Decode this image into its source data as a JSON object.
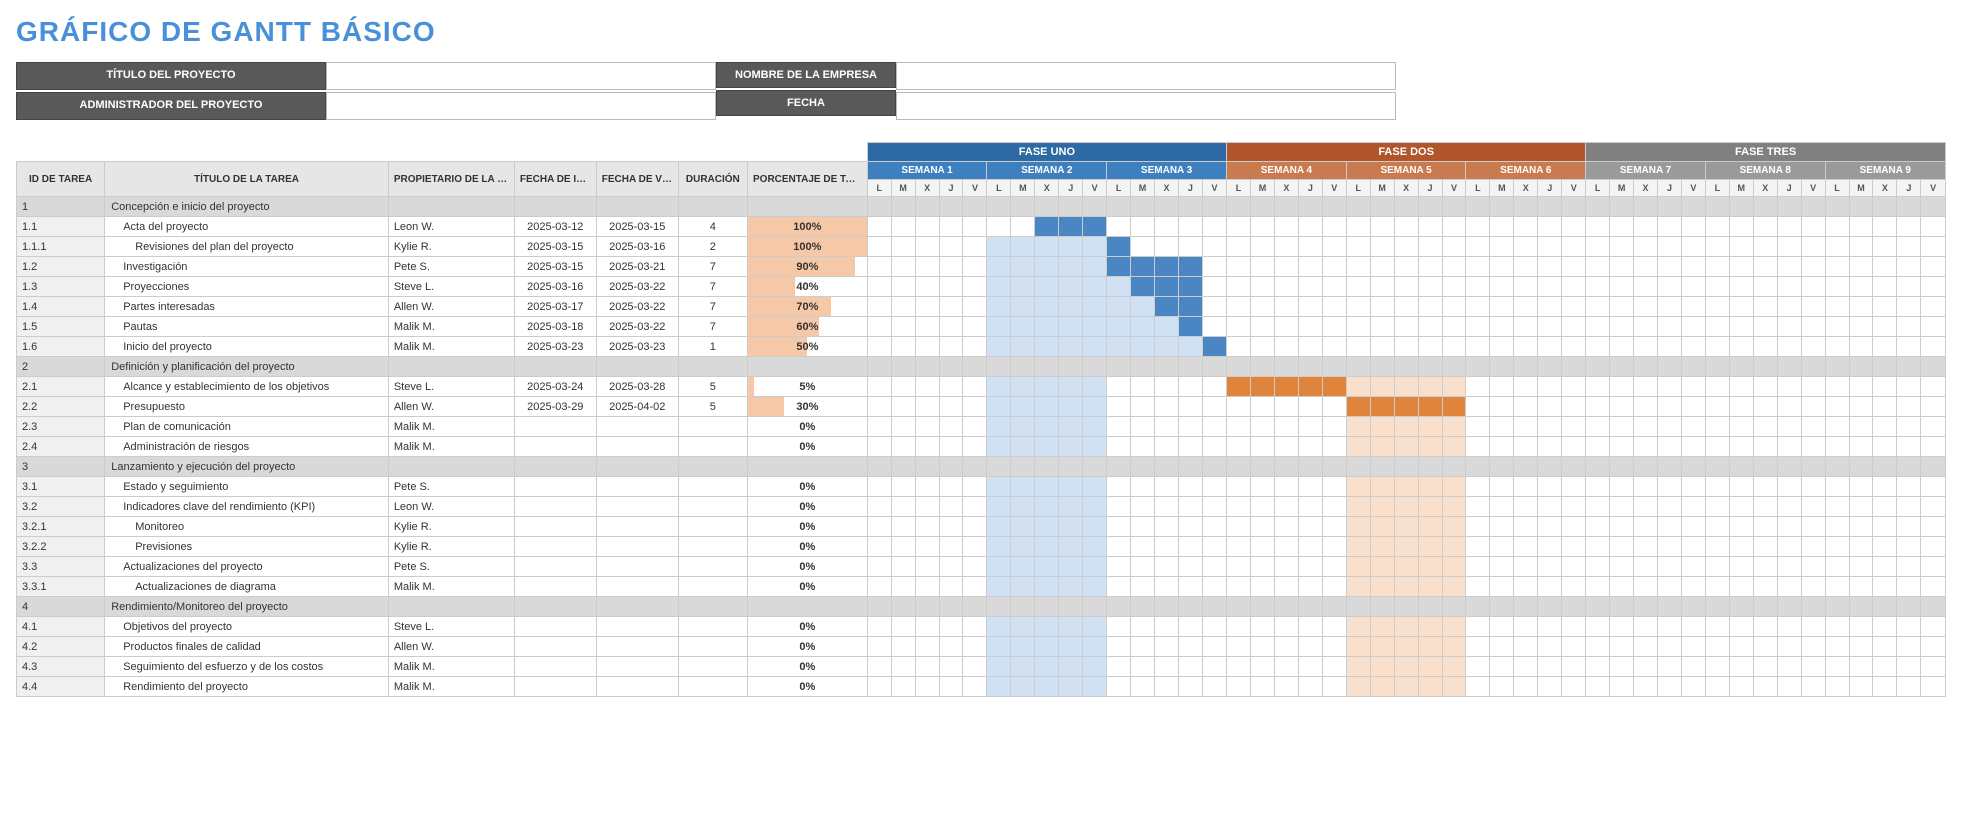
{
  "title": "GRÁFICO DE GANTT BÁSICO",
  "meta": {
    "project_title_label": "TÍTULO DEL PROYECTO",
    "project_manager_label": "ADMINISTRADOR DEL PROYECTO",
    "company_label": "NOMBRE DE LA EMPRESA",
    "date_label": "FECHA"
  },
  "columns": {
    "id": "ID DE TAREA",
    "title": "TÍTULO DE LA TAREA",
    "owner": "PROPIETARIO DE LA TAREA",
    "start": "FECHA DE INICIO",
    "due": "FECHA DE VENCIMIENTO",
    "duration": "DURACIÓN",
    "pct": "PORCENTAJE DE TAREA COMPLETADA"
  },
  "phases": [
    {
      "label": "FASE UNO",
      "cls": "ph1",
      "weekCls": "wk1",
      "weeks": [
        "SEMANA 1",
        "SEMANA 2",
        "SEMANA 3"
      ]
    },
    {
      "label": "FASE DOS",
      "cls": "ph2",
      "weekCls": "wk2",
      "weeks": [
        "SEMANA 4",
        "SEMANA 5",
        "SEMANA 6"
      ]
    },
    {
      "label": "FASE TRES",
      "cls": "ph3",
      "weekCls": "wk3",
      "weeks": [
        "SEMANA 7",
        "SEMANA 8",
        "SEMANA 9"
      ]
    }
  ],
  "days": [
    "L",
    "M",
    "X",
    "J",
    "V"
  ],
  "rows": [
    {
      "id": "1",
      "title": "Concepción e inicio del proyecto",
      "section": true
    },
    {
      "id": "1.1",
      "title": "Acta del proyecto",
      "indent": 1,
      "owner": "Leon W.",
      "start": "2025-03-12",
      "due": "2025-03-15",
      "dur": "4",
      "pct": 100,
      "bars": [
        {
          "s": 7,
          "e": 10,
          "c": "bar-blue-dark"
        }
      ]
    },
    {
      "id": "1.1.1",
      "title": "Revisiones del plan del proyecto",
      "indent": 2,
      "owner": "Kylie R.",
      "start": "2025-03-15",
      "due": "2025-03-16",
      "dur": "2",
      "pct": 100,
      "bars": [
        {
          "s": 5,
          "e": 10,
          "c": "bar-blue-light"
        },
        {
          "s": 10,
          "e": 11,
          "c": "bar-blue-dark"
        }
      ]
    },
    {
      "id": "1.2",
      "title": "Investigación",
      "indent": 1,
      "owner": "Pete S.",
      "start": "2025-03-15",
      "due": "2025-03-21",
      "dur": "7",
      "pct": 90,
      "bars": [
        {
          "s": 5,
          "e": 10,
          "c": "bar-blue-light"
        },
        {
          "s": 10,
          "e": 14,
          "c": "bar-blue-dark"
        }
      ]
    },
    {
      "id": "1.3",
      "title": "Proyecciones",
      "indent": 1,
      "owner": "Steve L.",
      "start": "2025-03-16",
      "due": "2025-03-22",
      "dur": "7",
      "pct": 40,
      "bars": [
        {
          "s": 5,
          "e": 11,
          "c": "bar-blue-light"
        },
        {
          "s": 11,
          "e": 14,
          "c": "bar-blue-dark"
        }
      ]
    },
    {
      "id": "1.4",
      "title": "Partes interesadas",
      "indent": 1,
      "owner": "Allen W.",
      "start": "2025-03-17",
      "due": "2025-03-22",
      "dur": "7",
      "pct": 70,
      "bars": [
        {
          "s": 5,
          "e": 12,
          "c": "bar-blue-light"
        },
        {
          "s": 12,
          "e": 14,
          "c": "bar-blue-dark"
        }
      ]
    },
    {
      "id": "1.5",
      "title": "Pautas",
      "indent": 1,
      "owner": "Malik M.",
      "start": "2025-03-18",
      "due": "2025-03-22",
      "dur": "7",
      "pct": 60,
      "bars": [
        {
          "s": 5,
          "e": 13,
          "c": "bar-blue-light"
        },
        {
          "s": 13,
          "e": 14,
          "c": "bar-blue-dark"
        }
      ]
    },
    {
      "id": "1.6",
      "title": "Inicio del proyecto",
      "indent": 1,
      "owner": "Malik M.",
      "start": "2025-03-23",
      "due": "2025-03-23",
      "dur": "1",
      "pct": 50,
      "bars": [
        {
          "s": 5,
          "e": 14,
          "c": "bar-blue-light"
        },
        {
          "s": 14,
          "e": 15,
          "c": "bar-blue-dark"
        }
      ]
    },
    {
      "id": "2",
      "title": "Definición y planificación del proyecto",
      "section": true
    },
    {
      "id": "2.1",
      "title": "Alcance y establecimiento de los objetivos",
      "indent": 1,
      "owner": "Steve L.",
      "start": "2025-03-24",
      "due": "2025-03-28",
      "dur": "5",
      "pct": 5,
      "bars": [
        {
          "s": 5,
          "e": 10,
          "c": "bar-blue-light"
        },
        {
          "s": 15,
          "e": 20,
          "c": "bar-orange-dark"
        },
        {
          "s": 20,
          "e": 25,
          "c": "bar-orange-light"
        }
      ]
    },
    {
      "id": "2.2",
      "title": "Presupuesto",
      "indent": 1,
      "owner": "Allen W.",
      "start": "2025-03-29",
      "due": "2025-04-02",
      "dur": "5",
      "pct": 30,
      "bars": [
        {
          "s": 5,
          "e": 10,
          "c": "bar-blue-light"
        },
        {
          "s": 20,
          "e": 25,
          "c": "bar-orange-dark"
        }
      ]
    },
    {
      "id": "2.3",
      "title": "Plan de comunicación",
      "indent": 1,
      "owner": "Malik M.",
      "pct": 0,
      "bars": [
        {
          "s": 5,
          "e": 10,
          "c": "bar-blue-light"
        },
        {
          "s": 20,
          "e": 25,
          "c": "bar-orange-light"
        }
      ]
    },
    {
      "id": "2.4",
      "title": "Administración de riesgos",
      "indent": 1,
      "owner": "Malik M.",
      "pct": 0,
      "bars": [
        {
          "s": 5,
          "e": 10,
          "c": "bar-blue-light"
        },
        {
          "s": 20,
          "e": 25,
          "c": "bar-orange-light"
        }
      ]
    },
    {
      "id": "3",
      "title": "Lanzamiento y ejecución del proyecto",
      "section": true
    },
    {
      "id": "3.1",
      "title": "Estado y seguimiento",
      "indent": 1,
      "owner": "Pete S.",
      "pct": 0,
      "bars": [
        {
          "s": 5,
          "e": 10,
          "c": "bar-blue-light"
        },
        {
          "s": 20,
          "e": 25,
          "c": "bar-orange-light"
        }
      ]
    },
    {
      "id": "3.2",
      "title": "Indicadores clave del rendimiento (KPI)",
      "indent": 1,
      "owner": "Leon W.",
      "pct": 0,
      "bars": [
        {
          "s": 5,
          "e": 10,
          "c": "bar-blue-light"
        },
        {
          "s": 20,
          "e": 25,
          "c": "bar-orange-light"
        }
      ]
    },
    {
      "id": "3.2.1",
      "title": "Monitoreo",
      "indent": 2,
      "owner": "Kylie R.",
      "pct": 0,
      "bars": [
        {
          "s": 5,
          "e": 10,
          "c": "bar-blue-light"
        },
        {
          "s": 20,
          "e": 25,
          "c": "bar-orange-light"
        }
      ]
    },
    {
      "id": "3.2.2",
      "title": "Previsiones",
      "indent": 2,
      "owner": "Kylie R.",
      "pct": 0,
      "bars": [
        {
          "s": 5,
          "e": 10,
          "c": "bar-blue-light"
        },
        {
          "s": 20,
          "e": 25,
          "c": "bar-orange-light"
        }
      ]
    },
    {
      "id": "3.3",
      "title": "Actualizaciones del proyecto",
      "indent": 1,
      "owner": "Pete S.",
      "pct": 0,
      "bars": [
        {
          "s": 5,
          "e": 10,
          "c": "bar-blue-light"
        },
        {
          "s": 20,
          "e": 25,
          "c": "bar-orange-light"
        }
      ]
    },
    {
      "id": "3.3.1",
      "title": "Actualizaciones de diagrama",
      "indent": 2,
      "owner": "Malik M.",
      "pct": 0,
      "bars": [
        {
          "s": 5,
          "e": 10,
          "c": "bar-blue-light"
        },
        {
          "s": 20,
          "e": 25,
          "c": "bar-orange-light"
        }
      ]
    },
    {
      "id": "4",
      "title": "Rendimiento/Monitoreo del proyecto",
      "section": true
    },
    {
      "id": "4.1",
      "title": "Objetivos del proyecto",
      "indent": 1,
      "owner": "Steve L.",
      "pct": 0,
      "bars": [
        {
          "s": 5,
          "e": 10,
          "c": "bar-blue-light"
        },
        {
          "s": 20,
          "e": 25,
          "c": "bar-orange-light"
        }
      ]
    },
    {
      "id": "4.2",
      "title": "Productos finales de calidad",
      "indent": 1,
      "owner": "Allen W.",
      "pct": 0,
      "bars": [
        {
          "s": 5,
          "e": 10,
          "c": "bar-blue-light"
        },
        {
          "s": 20,
          "e": 25,
          "c": "bar-orange-light"
        }
      ]
    },
    {
      "id": "4.3",
      "title": "Seguimiento del esfuerzo y de los costos",
      "indent": 1,
      "owner": "Malik M.",
      "pct": 0,
      "bars": [
        {
          "s": 5,
          "e": 10,
          "c": "bar-blue-light"
        },
        {
          "s": 20,
          "e": 25,
          "c": "bar-orange-light"
        }
      ]
    },
    {
      "id": "4.4",
      "title": "Rendimiento del proyecto",
      "indent": 1,
      "owner": "Malik M.",
      "pct": 0,
      "bars": [
        {
          "s": 5,
          "e": 10,
          "c": "bar-blue-light"
        },
        {
          "s": 20,
          "e": 25,
          "c": "bar-orange-light"
        }
      ]
    }
  ],
  "chart_data": {
    "type": "gantt",
    "title": "GRÁFICO DE GANTT BÁSICO",
    "phases": [
      "FASE UNO",
      "FASE DOS",
      "FASE TRES"
    ],
    "weeks": [
      "SEMANA 1",
      "SEMANA 2",
      "SEMANA 3",
      "SEMANA 4",
      "SEMANA 5",
      "SEMANA 6",
      "SEMANA 7",
      "SEMANA 8",
      "SEMANA 9"
    ],
    "days_per_week": [
      "L",
      "M",
      "X",
      "J",
      "V"
    ],
    "tasks": [
      {
        "id": "1.1",
        "title": "Acta del proyecto",
        "owner": "Leon W.",
        "start": "2025-03-12",
        "end": "2025-03-15",
        "duration": 4,
        "pct_complete": 100
      },
      {
        "id": "1.1.1",
        "title": "Revisiones del plan del proyecto",
        "owner": "Kylie R.",
        "start": "2025-03-15",
        "end": "2025-03-16",
        "duration": 2,
        "pct_complete": 100
      },
      {
        "id": "1.2",
        "title": "Investigación",
        "owner": "Pete S.",
        "start": "2025-03-15",
        "end": "2025-03-21",
        "duration": 7,
        "pct_complete": 90
      },
      {
        "id": "1.3",
        "title": "Proyecciones",
        "owner": "Steve L.",
        "start": "2025-03-16",
        "end": "2025-03-22",
        "duration": 7,
        "pct_complete": 40
      },
      {
        "id": "1.4",
        "title": "Partes interesadas",
        "owner": "Allen W.",
        "start": "2025-03-17",
        "end": "2025-03-22",
        "duration": 7,
        "pct_complete": 70
      },
      {
        "id": "1.5",
        "title": "Pautas",
        "owner": "Malik M.",
        "start": "2025-03-18",
        "end": "2025-03-22",
        "duration": 7,
        "pct_complete": 60
      },
      {
        "id": "1.6",
        "title": "Inicio del proyecto",
        "owner": "Malik M.",
        "start": "2025-03-23",
        "end": "2025-03-23",
        "duration": 1,
        "pct_complete": 50
      },
      {
        "id": "2.1",
        "title": "Alcance y establecimiento de los objetivos",
        "owner": "Steve L.",
        "start": "2025-03-24",
        "end": "2025-03-28",
        "duration": 5,
        "pct_complete": 5
      },
      {
        "id": "2.2",
        "title": "Presupuesto",
        "owner": "Allen W.",
        "start": "2025-03-29",
        "end": "2025-04-02",
        "duration": 5,
        "pct_complete": 30
      },
      {
        "id": "2.3",
        "title": "Plan de comunicación",
        "owner": "Malik M.",
        "pct_complete": 0
      },
      {
        "id": "2.4",
        "title": "Administración de riesgos",
        "owner": "Malik M.",
        "pct_complete": 0
      },
      {
        "id": "3.1",
        "title": "Estado y seguimiento",
        "owner": "Pete S.",
        "pct_complete": 0
      },
      {
        "id": "3.2",
        "title": "Indicadores clave del rendimiento (KPI)",
        "owner": "Leon W.",
        "pct_complete": 0
      },
      {
        "id": "3.2.1",
        "title": "Monitoreo",
        "owner": "Kylie R.",
        "pct_complete": 0
      },
      {
        "id": "3.2.2",
        "title": "Previsiones",
        "owner": "Kylie R.",
        "pct_complete": 0
      },
      {
        "id": "3.3",
        "title": "Actualizaciones del proyecto",
        "owner": "Pete S.",
        "pct_complete": 0
      },
      {
        "id": "3.3.1",
        "title": "Actualizaciones de diagrama",
        "owner": "Malik M.",
        "pct_complete": 0
      },
      {
        "id": "4.1",
        "title": "Objetivos del proyecto",
        "owner": "Steve L.",
        "pct_complete": 0
      },
      {
        "id": "4.2",
        "title": "Productos finales de calidad",
        "owner": "Allen W.",
        "pct_complete": 0
      },
      {
        "id": "4.3",
        "title": "Seguimiento del esfuerzo y de los costos",
        "owner": "Malik M.",
        "pct_complete": 0
      },
      {
        "id": "4.4",
        "title": "Rendimiento del proyecto",
        "owner": "Malik M.",
        "pct_complete": 0
      }
    ]
  }
}
